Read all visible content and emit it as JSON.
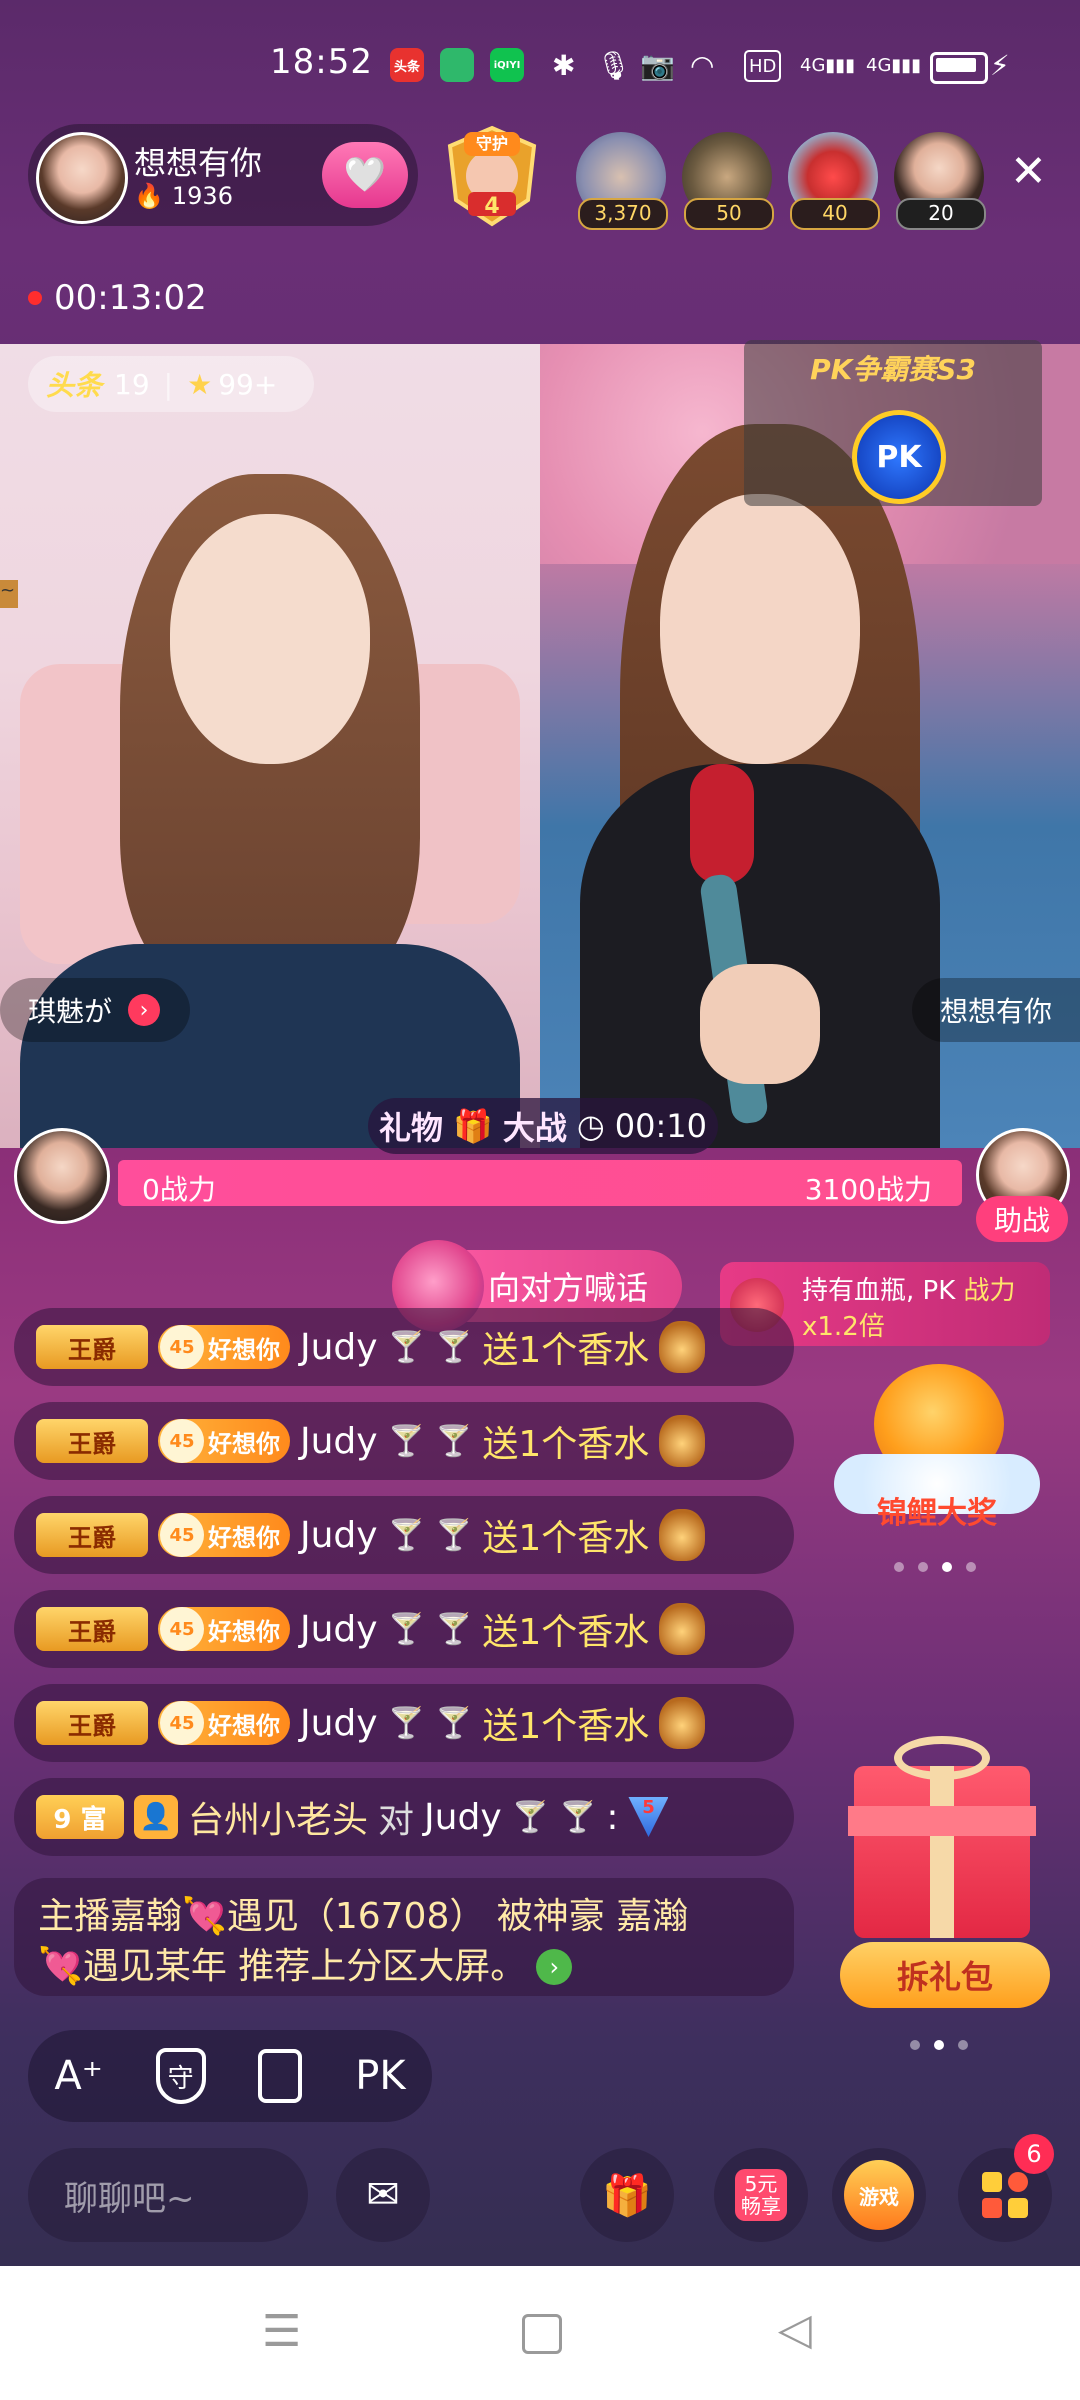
{
  "status_bar": {
    "time": "18:52",
    "apps": [
      "头条",
      "",
      "iQIYI"
    ],
    "hd_label": "HD",
    "net_a": "4G",
    "net_b": "4G"
  },
  "host": {
    "name": "想想有你",
    "hot_count": "1936"
  },
  "guard_label": "守护",
  "guard_level": "4",
  "top_fans": [
    {
      "count": "3,370"
    },
    {
      "count": "50"
    },
    {
      "count": "40"
    },
    {
      "count": "20"
    }
  ],
  "live_timer": "00:13:02",
  "left_panel": {
    "toutiao_label": "头条",
    "toutiao_count": "19",
    "star_count": "99+",
    "streamer_name": "琪魅が"
  },
  "right_panel": {
    "streamer_name": "想想有你",
    "pk_title": "PK争霸赛S3",
    "pk_label": "PK"
  },
  "battle": {
    "title_a": "礼物",
    "title_b": "大战",
    "countdown": "00:10",
    "left_power": "0战力",
    "right_power": "3100战力",
    "assist_label": "助战"
  },
  "shout": {
    "label": "向对方喊话"
  },
  "boost": {
    "line1_a": "持有血瓶, PK ",
    "line1_b": "战力",
    "line2": "x1.2倍"
  },
  "chat": {
    "gift_rows": [
      {
        "rank": "王爵",
        "fan_level": "45",
        "fan_club": "好想你",
        "user": "Judy",
        "action": "送1个香水"
      },
      {
        "rank": "王爵",
        "fan_level": "45",
        "fan_club": "好想你",
        "user": "Judy",
        "action": "送1个香水"
      },
      {
        "rank": "王爵",
        "fan_level": "45",
        "fan_club": "好想你",
        "user": "Judy",
        "action": "送1个香水"
      },
      {
        "rank": "王爵",
        "fan_level": "45",
        "fan_club": "好想你",
        "user": "Judy",
        "action": "送1个香水"
      },
      {
        "rank": "王爵",
        "fan_level": "45",
        "fan_club": "好想你",
        "user": "Judy",
        "action": "送1个香水"
      }
    ],
    "rich_row": {
      "rich_level": "9 富",
      "user": "台州小老头",
      "to_word": "对",
      "target": "Judy",
      "colon": ":",
      "level_badge": "5"
    },
    "system_line1": "主播嘉翰💘遇见（16708） 被神豪 嘉瀚",
    "system_line2": "💘遇见某年 推荐上分区大屏。"
  },
  "side": {
    "koi_label": "锦鲤大奖",
    "gift_button": "拆礼包"
  },
  "toolbar": {
    "font_btn": "A⁺",
    "guard_btn": "守",
    "pk_btn": "PK",
    "chat_placeholder": "聊聊吧~",
    "promo_label_1": "5元",
    "promo_label_2": "畅享",
    "game_label": "游戏",
    "more_badge": "6"
  },
  "colors": {
    "accent_pink": "#ff4f8f",
    "gold": "#ffe56a"
  }
}
